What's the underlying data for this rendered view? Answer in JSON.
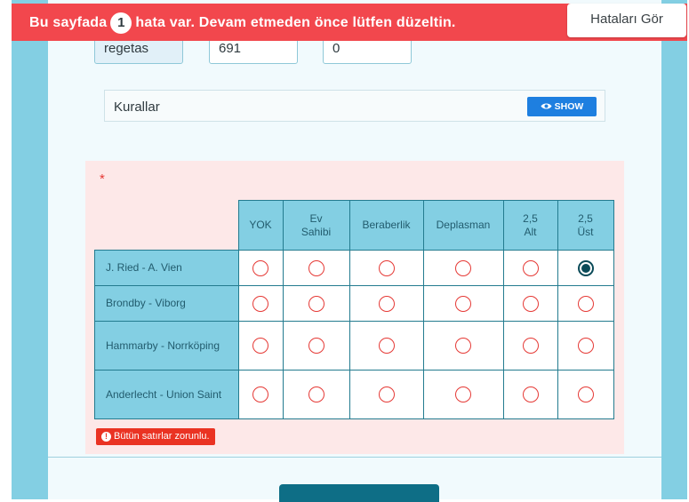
{
  "top_fields": [
    {
      "value": "regetas"
    },
    {
      "value": "691"
    },
    {
      "value": "0"
    }
  ],
  "error_bar": {
    "text_before": "Bu sayfada",
    "count": "1",
    "text_after": "hata var. Devam etmeden önce lütfen düzeltin.",
    "button_label": "Hataları Gör"
  },
  "rules": {
    "label": "Kurallar",
    "show_label": "SHOW"
  },
  "question": {
    "required_marker": "*",
    "columns": [
      "YOK",
      "Ev Sahibi",
      "Beraberlik",
      "Deplasman",
      "2,5 Alt",
      "2,5 Üst"
    ],
    "rows": [
      {
        "label": "J. Ried - A. Vien",
        "selected": 5
      },
      {
        "label": "Brondby - Viborg",
        "selected": -1
      },
      {
        "label": "Hammarby - Norrköping",
        "selected": -1
      },
      {
        "label": "Anderlecht - Union Saint",
        "selected": -1
      }
    ],
    "error_text": "Bütün satırlar zorunlu.",
    "error_icon": "!"
  },
  "colors": {
    "error_red": "#f2474d",
    "header_cyan": "#83cfe3",
    "primary_blue": "#1e7fe0",
    "dark_teal": "#0e6e86"
  }
}
